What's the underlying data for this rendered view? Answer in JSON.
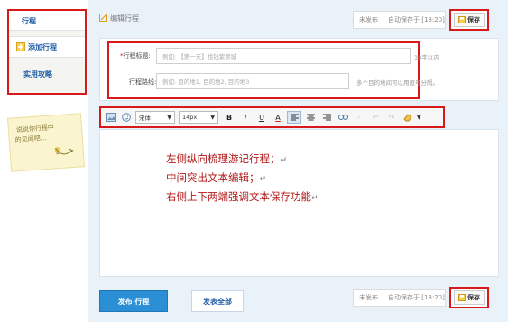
{
  "sidebar": {
    "tab_label": "行程",
    "items": [
      {
        "label": "添加行程",
        "icon": "add-plus-icon"
      },
      {
        "label": "实用攻略"
      }
    ],
    "sticky_note": {
      "line1": "说说你行程中",
      "line2": "的见闻吧..."
    }
  },
  "header": {
    "title": "编辑行程",
    "status": "未发布",
    "autosave": "自动保存于 [18:20]",
    "save_label": "保存"
  },
  "form": {
    "title_label": "行程标题:",
    "title_placeholder": "例如: 【第一天】找钱紫禁城",
    "title_hint": "30字以内",
    "route_label": "行程路线:",
    "route_placeholder": "例如: 目的地1, 目的地2, 目的地3",
    "route_hint": "多个目的地间可以用逗号分隔。"
  },
  "toolbar": {
    "font_family": "宋体",
    "font_size": "14px",
    "bold": "B",
    "italic": "I",
    "underline": "U",
    "font_color": "A",
    "active_tool": "align-left"
  },
  "editor": {
    "lines": [
      "左侧纵向梳理游记行程；",
      "中间突出文本编辑；",
      "右侧上下两端强调文本保存功能"
    ],
    "return_mark": "↵"
  },
  "footer": {
    "publish_label": "发布 行程",
    "publish_all_label": "发表全部",
    "status": "未发布",
    "autosave": "自动保存于 [18:20]",
    "save_label": "保存"
  },
  "colors": {
    "annotation_red": "#d61a1a",
    "link_blue": "#1b5aa6",
    "publish_blue": "#2b8fd6",
    "editor_text": "#b01818",
    "main_bg": "#e9f1f9"
  }
}
